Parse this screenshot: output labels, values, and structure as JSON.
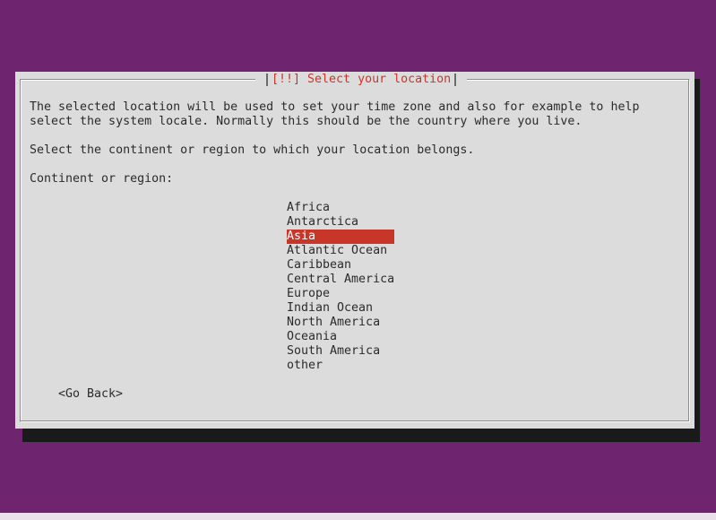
{
  "dialog": {
    "title": "[!!] Select your location",
    "description_line1": "The selected location will be used to set your time zone and also for example to help",
    "description_line2": "select the system locale. Normally this should be the country where you live.",
    "prompt": "Select the continent or region to which your location belongs.",
    "field_label": "Continent or region:",
    "options": [
      "Africa",
      "Antarctica",
      "Asia",
      "Atlantic Ocean",
      "Caribbean",
      "Central America",
      "Europe",
      "Indian Ocean",
      "North America",
      "Oceania",
      "South America",
      "other"
    ],
    "selected_option": "Asia",
    "go_back_label": "<Go Back>"
  },
  "colors": {
    "background": "#6f2470",
    "dialog": "#dddcdc",
    "accent": "#c8362a"
  }
}
